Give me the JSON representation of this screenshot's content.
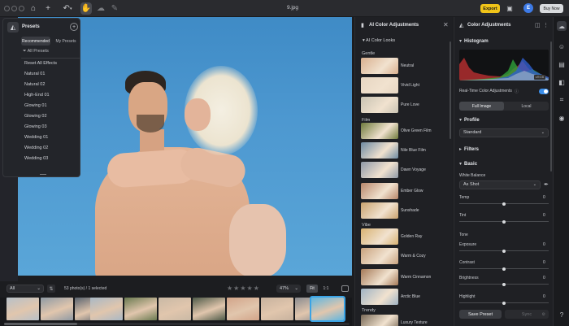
{
  "window": {
    "title": "9.jpg"
  },
  "toolbar": {
    "export_label": "Export",
    "avatar_initial": "E",
    "buy_now_label": "Buy Now"
  },
  "presets_panel": {
    "title": "Presets",
    "tabs": [
      "Recommended",
      "My Presets"
    ],
    "filter_label": "All Presets",
    "items": [
      "Reset All Effects",
      "Natural 01",
      "Natural 02",
      "High-End 01",
      "Glowing 01",
      "Glowing 02",
      "Glowing 03",
      "Wedding 01",
      "Wedding 02",
      "Wedding 03"
    ]
  },
  "filmbar": {
    "filter_value": "All",
    "photo_count": "53 photo(s) / 1 selected",
    "zoom_value": "47%",
    "fit_label": "Fit",
    "one_to_one_label": "1:1"
  },
  "ai_panel": {
    "title": "AI Color Adjustments",
    "looks_label": "AI Color Looks",
    "categories": {
      "gentle": "Gentle",
      "film": "Film",
      "vibe": "Vibe",
      "trendy": "Trendy"
    },
    "looks": [
      {
        "label": "Neutral",
        "color": "#d9b08f"
      },
      {
        "label": "Vivid Light",
        "color": "#e7d6c2"
      },
      {
        "label": "Pure Love",
        "color": "#c9c3b3"
      },
      {
        "label": "Olive Green Film",
        "color": "#6e7a3c"
      },
      {
        "label": "Nile Blue Film",
        "color": "#6d8aa2"
      },
      {
        "label": "Dawn Voyage",
        "color": "#8e98a6"
      },
      {
        "label": "Ember Glow",
        "color": "#b8866a"
      },
      {
        "label": "Sunshade",
        "color": "#c9a26e"
      },
      {
        "label": "Golden Ray",
        "color": "#d8b272"
      },
      {
        "label": "Warm & Cozy",
        "color": "#c8a27e"
      },
      {
        "label": "Warm Cinnamon",
        "color": "#a67a58"
      },
      {
        "label": "Arctic Blue",
        "color": "#9fb3c4"
      },
      {
        "label": "Luxury Texture",
        "color": "#7a6a58"
      }
    ]
  },
  "color_panel": {
    "title": "Color Adjustments",
    "histogram_label": "Histogram",
    "histogram_tag": "sRGB",
    "realtime_label": "Real-Time Color Adjustments",
    "realtime_on": true,
    "scope_tabs": [
      "Full Image",
      "Local"
    ],
    "profile_label": "Profile",
    "profile_value": "Standard",
    "filters_label": "Filters",
    "basic_label": "Basic",
    "white_balance_label": "White Balance",
    "white_balance_value": "As Shot",
    "sliders": [
      {
        "label": "Temp",
        "value": "0"
      },
      {
        "label": "Tint",
        "value": "0"
      },
      {
        "label": "Exposure",
        "value": "0"
      },
      {
        "label": "Contrast",
        "value": "0"
      },
      {
        "label": "Brightness",
        "value": "0"
      },
      {
        "label": "Highlight",
        "value": "0"
      }
    ],
    "tone_label": "Tone",
    "save_preset_label": "Save Preset",
    "sync_label": "Sync"
  },
  "thumbnails": [
    {
      "color": "#b7c0c8"
    },
    {
      "color": "#8f9aa4"
    },
    {
      "color": "#5a6470"
    },
    {
      "color": "#a9b8c5"
    },
    {
      "color": "#6a7a50"
    },
    {
      "color": "#c9b9a5"
    },
    {
      "color": "#4e5a48"
    },
    {
      "color": "#d2a489"
    },
    {
      "color": "#c7b29e"
    },
    {
      "color": "#8a8c90"
    },
    {
      "color": "#5fb6e0",
      "selected": true
    }
  ],
  "colors": {
    "accent": "#3a8eea",
    "export": "#f0c419",
    "selection": "#3aa3e5"
  }
}
